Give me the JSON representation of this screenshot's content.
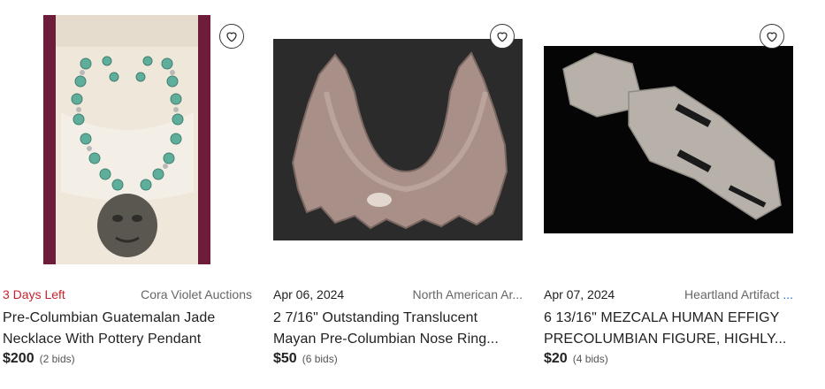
{
  "listings": [
    {
      "date": "3 Days Left",
      "house": "Cora Violet Auctions",
      "title_line1": "Pre-Columbian Guatemalan Jade",
      "title_line2": "Necklace With Pottery Pendant",
      "price": "$200",
      "bids": "(2 bids)",
      "image_icon": "necklace-photo"
    },
    {
      "date": "Apr 06, 2024",
      "house": "North American Ar...",
      "title_line1": "2 7/16\" Outstanding Translucent",
      "title_line2": "Mayan Pre-Columbian Nose Ring...",
      "price": "$50",
      "bids": "(6 bids)",
      "image_icon": "nose-ring-photo"
    },
    {
      "date": "Apr 07, 2024",
      "house": "Heartland Artifact",
      "house_more": "...",
      "title_line1": "6 13/16\" MEZCALA HUMAN EFFIGY",
      "title_line2": "PRECOLUMBIAN FIGURE, HIGHLY...",
      "price": "$20",
      "bids": "(4 bids)",
      "image_icon": "effigy-photo"
    }
  ],
  "colors": {
    "urgent": "#c8232c",
    "link": "#1a73c9",
    "text": "#222222",
    "muted": "#666666"
  },
  "icons": {
    "favorite": "heart-outline-icon"
  }
}
